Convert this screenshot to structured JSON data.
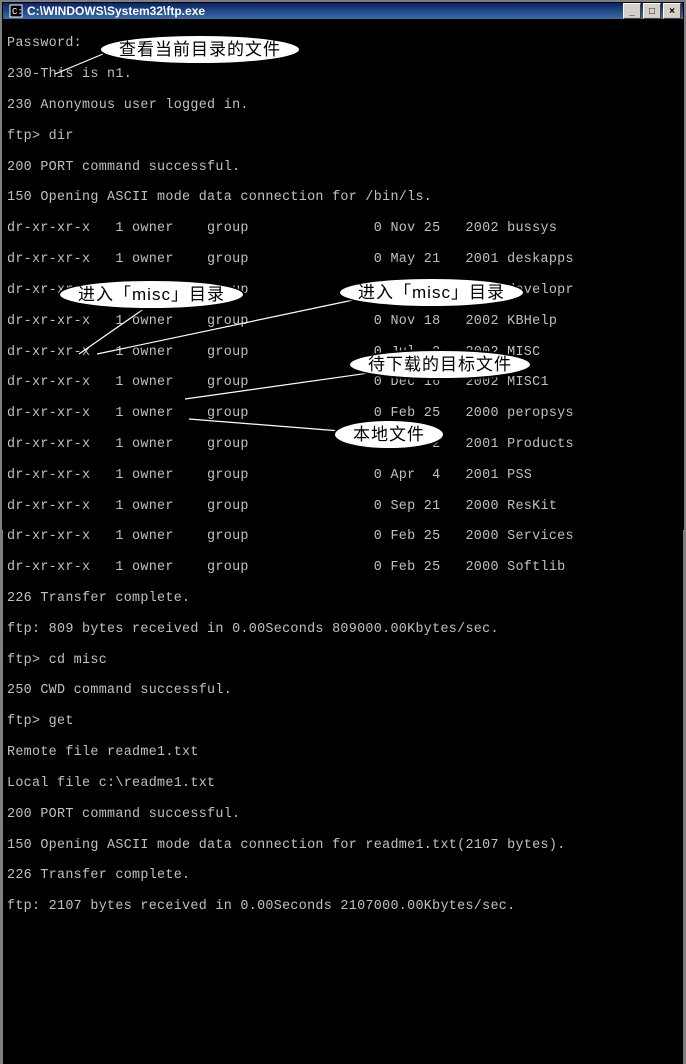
{
  "window": {
    "title": "C:\\WINDOWS\\System32\\ftp.exe",
    "minimize": "_",
    "maximize": "□",
    "close": "×"
  },
  "term": {
    "l01": "Password:",
    "l02": "230-This is n1.",
    "l03": "230 Anonymous user logged in.",
    "l04": "ftp> dir",
    "l05": "200 PORT command successful.",
    "l06": "150 Opening ASCII mode data connection for /bin/ls.",
    "l07": "dr-xr-xr-x   1 owner    group               0 Nov 25   2002 bussys",
    "l08": "dr-xr-xr-x   1 owner    group               0 May 21   2001 deskapps",
    "l09": "dr-xr-xr-x   1 owner    group               0 Apr 20   2001 developr",
    "l10": "dr-xr-xr-x   1 owner    group               0 Nov 18   2002 KBHelp",
    "l11": "dr-xr-xr-x   1 owner    group               0 Jul  2   2002 MISC",
    "l12": "dr-xr-xr-x   1 owner    group               0 Dec 16   2002 MISC1",
    "l13": "dr-xr-xr-x   1 owner    group               0 Feb 25   2000 peropsys",
    "l14": "dr-xr-xr-x   1 owner    group               0 Jan  2   2001 Products",
    "l15": "dr-xr-xr-x   1 owner    group               0 Apr  4   2001 PSS",
    "l16": "dr-xr-xr-x   1 owner    group               0 Sep 21   2000 ResKit",
    "l17": "dr-xr-xr-x   1 owner    group               0 Feb 25   2000 Services",
    "l18": "dr-xr-xr-x   1 owner    group               0 Feb 25   2000 Softlib",
    "l19": "226 Transfer complete.",
    "l20": "ftp: 809 bytes received in 0.00Seconds 809000.00Kbytes/sec.",
    "l21": "ftp> cd misc",
    "l22": "250 CWD command successful.",
    "l23": "ftp> get",
    "l24": "Remote file readme1.txt",
    "l25": "Local file c:\\readme1.txt",
    "l26": "200 PORT command successful.",
    "l27": "150 Opening ASCII mode data connection for readme1.txt(2107 bytes).",
    "l28": "226 Transfer complete.",
    "l29": "ftp: 2107 bytes received in 0.00Seconds 2107000.00Kbytes/sec."
  },
  "callouts": {
    "c1": "查看当前目录的文件",
    "c2": "进入「misc」目录",
    "c3": "进入「misc」目录",
    "c4": "待下载的目标文件",
    "c5": "本地文件"
  }
}
